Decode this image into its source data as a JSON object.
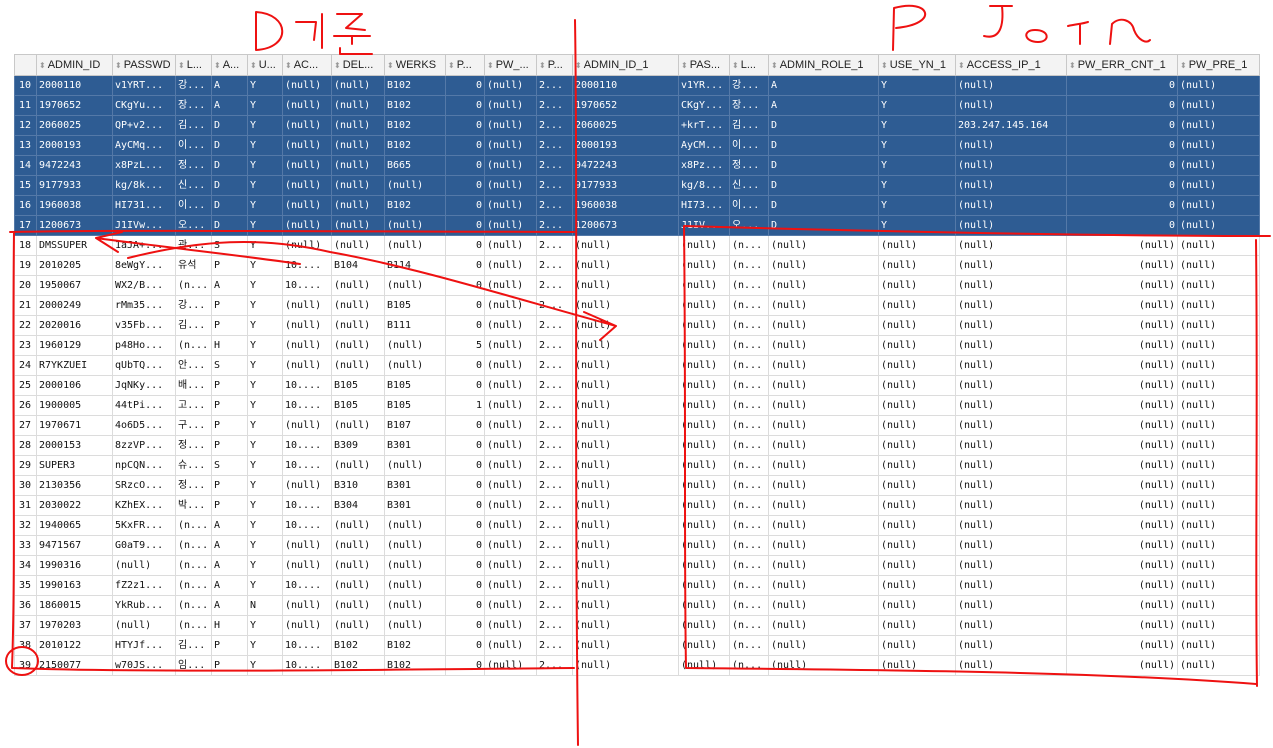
{
  "columns": [
    "ADMIN_ID",
    "PASSWD",
    "L...",
    "A...",
    "U...",
    "AC...",
    "DEL...",
    "WERKS",
    "P...",
    "PW_...",
    "P...",
    "ADMIN_ID_1",
    "PAS...",
    "L...",
    "ADMIN_ROLE_1",
    "USE_YN_1",
    "ACCESS_IP_1",
    "PW_ERR_CNT_1",
    "PW_PRE_1"
  ],
  "rows": [
    [
      "10",
      "2000110",
      "v1YRT...",
      "강...",
      "A",
      "Y",
      "(null)",
      "(null)",
      "B102",
      "0",
      "(null)",
      "2...",
      "2000110",
      "v1YR...",
      "강...",
      "A",
      "Y",
      "(null)",
      "0",
      "(null)"
    ],
    [
      "11",
      "1970652",
      "CKgYu...",
      "장...",
      "A",
      "Y",
      "(null)",
      "(null)",
      "B102",
      "0",
      "(null)",
      "2...",
      "1970652",
      "CKgY...",
      "장...",
      "A",
      "Y",
      "(null)",
      "0",
      "(null)"
    ],
    [
      "12",
      "2060025",
      "QP+v2...",
      "김...",
      "D",
      "Y",
      "(null)",
      "(null)",
      "B102",
      "0",
      "(null)",
      "2...",
      "2060025",
      "+krT...",
      "김...",
      "D",
      "Y",
      "203.247.145.164",
      "0",
      "(null)"
    ],
    [
      "13",
      "2000193",
      "AyCMq...",
      "이...",
      "D",
      "Y",
      "(null)",
      "(null)",
      "B102",
      "0",
      "(null)",
      "2...",
      "2000193",
      "AyCM...",
      "이...",
      "D",
      "Y",
      "(null)",
      "0",
      "(null)"
    ],
    [
      "14",
      "9472243",
      "x8PzL...",
      "정...",
      "D",
      "Y",
      "(null)",
      "(null)",
      "B665",
      "0",
      "(null)",
      "2...",
      "9472243",
      "x8Pz...",
      "정...",
      "D",
      "Y",
      "(null)",
      "0",
      "(null)"
    ],
    [
      "15",
      "9177933",
      "kg/8k...",
      "신...",
      "D",
      "Y",
      "(null)",
      "(null)",
      "(null)",
      "0",
      "(null)",
      "2...",
      "9177933",
      "kg/8...",
      "신...",
      "D",
      "Y",
      "(null)",
      "0",
      "(null)"
    ],
    [
      "16",
      "1960038",
      "HI731...",
      "이...",
      "D",
      "Y",
      "(null)",
      "(null)",
      "B102",
      "0",
      "(null)",
      "2...",
      "1960038",
      "HI73...",
      "이...",
      "D",
      "Y",
      "(null)",
      "0",
      "(null)"
    ],
    [
      "17",
      "1200673",
      "J1IVw...",
      "오...",
      "D",
      "Y",
      "(null)",
      "(null)",
      "(null)",
      "0",
      "(null)",
      "2...",
      "1200673",
      "J1IV...",
      "오...",
      "D",
      "Y",
      "(null)",
      "0",
      "(null)"
    ],
    [
      "18",
      "DMSSUPER",
      "1aJA+...",
      "관...",
      "S",
      "Y",
      "(null)",
      "(null)",
      "(null)",
      "0",
      "(null)",
      "2...",
      "(null)",
      "(null)",
      "(n...",
      "(null)",
      "(null)",
      "(null)",
      "(null)",
      "(null)"
    ],
    [
      "19",
      "2010205",
      "8eWgY...",
      "유석",
      "P",
      "Y",
      "10....",
      "B104",
      "B114",
      "0",
      "(null)",
      "2...",
      "(null)",
      "(null)",
      "(n...",
      "(null)",
      "(null)",
      "(null)",
      "(null)",
      "(null)"
    ],
    [
      "20",
      "1950067",
      "WX2/B...",
      "(n...",
      "A",
      "Y",
      "10....",
      "(null)",
      "(null)",
      "0",
      "(null)",
      "2...",
      "(null)",
      "(null)",
      "(n...",
      "(null)",
      "(null)",
      "(null)",
      "(null)",
      "(null)"
    ],
    [
      "21",
      "2000249",
      "rMm35...",
      "강...",
      "P",
      "Y",
      "(null)",
      "(null)",
      "B105",
      "0",
      "(null)",
      "2...",
      "(null)",
      "(null)",
      "(n...",
      "(null)",
      "(null)",
      "(null)",
      "(null)",
      "(null)"
    ],
    [
      "22",
      "2020016",
      "v35Fb...",
      "김...",
      "P",
      "Y",
      "(null)",
      "(null)",
      "B111",
      "0",
      "(null)",
      "2...",
      "(null)",
      "(null)",
      "(n...",
      "(null)",
      "(null)",
      "(null)",
      "(null)",
      "(null)"
    ],
    [
      "23",
      "1960129",
      "p48Ho...",
      "(n...",
      "H",
      "Y",
      "(null)",
      "(null)",
      "(null)",
      "5",
      "(null)",
      "2...",
      "(null)",
      "(null)",
      "(n...",
      "(null)",
      "(null)",
      "(null)",
      "(null)",
      "(null)"
    ],
    [
      "24",
      "R7YKZUEI",
      "qUbTQ...",
      "안...",
      "S",
      "Y",
      "(null)",
      "(null)",
      "(null)",
      "0",
      "(null)",
      "2...",
      "(null)",
      "(null)",
      "(n...",
      "(null)",
      "(null)",
      "(null)",
      "(null)",
      "(null)"
    ],
    [
      "25",
      "2000106",
      "JqNKy...",
      "배...",
      "P",
      "Y",
      "10....",
      "B105",
      "B105",
      "0",
      "(null)",
      "2...",
      "(null)",
      "(null)",
      "(n...",
      "(null)",
      "(null)",
      "(null)",
      "(null)",
      "(null)"
    ],
    [
      "26",
      "1900005",
      "44tPi...",
      "고...",
      "P",
      "Y",
      "10....",
      "B105",
      "B105",
      "1",
      "(null)",
      "2...",
      "(null)",
      "(null)",
      "(n...",
      "(null)",
      "(null)",
      "(null)",
      "(null)",
      "(null)"
    ],
    [
      "27",
      "1970671",
      "4o6D5...",
      "구...",
      "P",
      "Y",
      "(null)",
      "(null)",
      "B107",
      "0",
      "(null)",
      "2...",
      "(null)",
      "(null)",
      "(n...",
      "(null)",
      "(null)",
      "(null)",
      "(null)",
      "(null)"
    ],
    [
      "28",
      "2000153",
      "8zzVP...",
      "정...",
      "P",
      "Y",
      "10....",
      "B309",
      "B301",
      "0",
      "(null)",
      "2...",
      "(null)",
      "(null)",
      "(n...",
      "(null)",
      "(null)",
      "(null)",
      "(null)",
      "(null)"
    ],
    [
      "29",
      "SUPER3",
      "npCQN...",
      "슈...",
      "S",
      "Y",
      "10....",
      "(null)",
      "(null)",
      "0",
      "(null)",
      "2...",
      "(null)",
      "(null)",
      "(n...",
      "(null)",
      "(null)",
      "(null)",
      "(null)",
      "(null)"
    ],
    [
      "30",
      "2130356",
      "SRzcO...",
      "정...",
      "P",
      "Y",
      "(null)",
      "B310",
      "B301",
      "0",
      "(null)",
      "2...",
      "(null)",
      "(null)",
      "(n...",
      "(null)",
      "(null)",
      "(null)",
      "(null)",
      "(null)"
    ],
    [
      "31",
      "2030022",
      "KZhEX...",
      "박...",
      "P",
      "Y",
      "10....",
      "B304",
      "B301",
      "0",
      "(null)",
      "2...",
      "(null)",
      "(null)",
      "(n...",
      "(null)",
      "(null)",
      "(null)",
      "(null)",
      "(null)"
    ],
    [
      "32",
      "1940065",
      "5KxFR...",
      "(n...",
      "A",
      "Y",
      "10....",
      "(null)",
      "(null)",
      "0",
      "(null)",
      "2...",
      "(null)",
      "(null)",
      "(n...",
      "(null)",
      "(null)",
      "(null)",
      "(null)",
      "(null)"
    ],
    [
      "33",
      "9471567",
      "G0aT9...",
      "(n...",
      "A",
      "Y",
      "(null)",
      "(null)",
      "(null)",
      "0",
      "(null)",
      "2...",
      "(null)",
      "(null)",
      "(n...",
      "(null)",
      "(null)",
      "(null)",
      "(null)",
      "(null)"
    ],
    [
      "34",
      "1990316",
      "(null)",
      "(n...",
      "A",
      "Y",
      "(null)",
      "(null)",
      "(null)",
      "0",
      "(null)",
      "2...",
      "(null)",
      "(null)",
      "(n...",
      "(null)",
      "(null)",
      "(null)",
      "(null)",
      "(null)"
    ],
    [
      "35",
      "1990163",
      "fZ2z1...",
      "(n...",
      "A",
      "Y",
      "10....",
      "(null)",
      "(null)",
      "0",
      "(null)",
      "2...",
      "(null)",
      "(null)",
      "(n...",
      "(null)",
      "(null)",
      "(null)",
      "(null)",
      "(null)"
    ],
    [
      "36",
      "1860015",
      "YkRub...",
      "(n...",
      "A",
      "N",
      "(null)",
      "(null)",
      "(null)",
      "0",
      "(null)",
      "2...",
      "(null)",
      "(null)",
      "(n...",
      "(null)",
      "(null)",
      "(null)",
      "(null)",
      "(null)"
    ],
    [
      "37",
      "1970203",
      "(null)",
      "(n...",
      "H",
      "Y",
      "(null)",
      "(null)",
      "(null)",
      "0",
      "(null)",
      "2...",
      "(null)",
      "(null)",
      "(n...",
      "(null)",
      "(null)",
      "(null)",
      "(null)",
      "(null)"
    ],
    [
      "38",
      "2010122",
      "HTYJf...",
      "김...",
      "P",
      "Y",
      "10....",
      "B102",
      "B102",
      "0",
      "(null)",
      "2...",
      "(null)",
      "(null)",
      "(n...",
      "(null)",
      "(null)",
      "(null)",
      "(null)",
      "(null)"
    ],
    [
      "39",
      "2150077",
      "w70JS...",
      "임...",
      "P",
      "Y",
      "10....",
      "B102",
      "B102",
      "0",
      "(null)",
      "2...",
      "(null)",
      "(null)",
      "(n...",
      "(null)",
      "(null)",
      "(null)",
      "(null)",
      "(null)"
    ]
  ],
  "selected_row_count": 8,
  "numeric_columns": [
    9,
    18
  ],
  "annotations": {
    "left_label": "D 기준",
    "right_label": "P Join",
    "color": "#ee1111"
  },
  "colors": {
    "selection": "#2e5c93",
    "header": "#f3f3f3"
  }
}
